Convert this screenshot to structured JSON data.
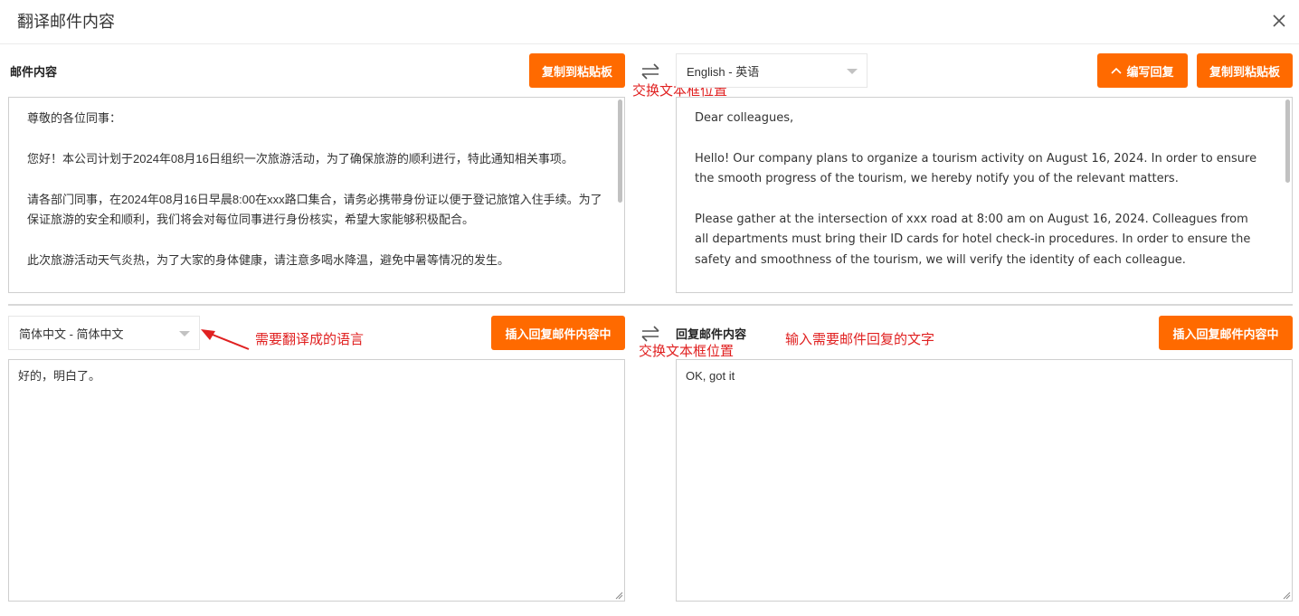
{
  "dialog": {
    "title": "翻译邮件内容",
    "close_icon": "close-icon"
  },
  "top_left": {
    "label": "邮件内容",
    "copy_button": "复制到粘贴板",
    "paragraphs": [
      "尊敬的各位同事：",
      "您好！本公司计划于2024年08月16日组织一次旅游活动，为了确保旅游的顺利进行，特此通知相关事项。",
      "请各部门同事，在2024年08月16日早晨8:00在xxx路口集合，请务必携带身份证以便于登记旅馆入住手续。为了保证旅游的安全和顺利，我们将会对每位同事进行身份核实，希望大家能够积极配合。",
      "此次旅游活动天气炎热，为了大家的身体健康，请注意多喝水降温，避免中暑等情况的发生。"
    ]
  },
  "top_right": {
    "language_select": "English - 英语",
    "compose_reply_button": "编写回复",
    "copy_button": "复制到粘贴板",
    "paragraphs": [
      "Dear colleagues,",
      "Hello! Our company plans to organize a tourism activity on August 16, 2024. In order to ensure the smooth progress of the tourism, we hereby notify you of the relevant matters.",
      "Please gather at the intersection of xxx road at 8:00 am on August 16, 2024. Colleagues from all departments must bring their ID cards for hotel check-in procedures. In order to ensure the safety and smoothness of the tourism, we will verify the identity of each colleague."
    ]
  },
  "bottom_left": {
    "language_select": "简体中文 - 简体中文",
    "insert_button": "插入回复邮件内容中",
    "reply_translation": "好的，明白了。"
  },
  "bottom_right": {
    "label": "回复邮件内容",
    "insert_button": "插入回复邮件内容中",
    "reply_text": "OK, got it"
  },
  "annotations": {
    "swap_top": "交换文本框位置",
    "swap_bottom": "交换文本框位置",
    "target_language": "需要翻译成的语言",
    "reply_hint": "输入需要邮件回复的文字"
  },
  "colors": {
    "accent": "#ff6a00",
    "annotation": "#e02020"
  }
}
